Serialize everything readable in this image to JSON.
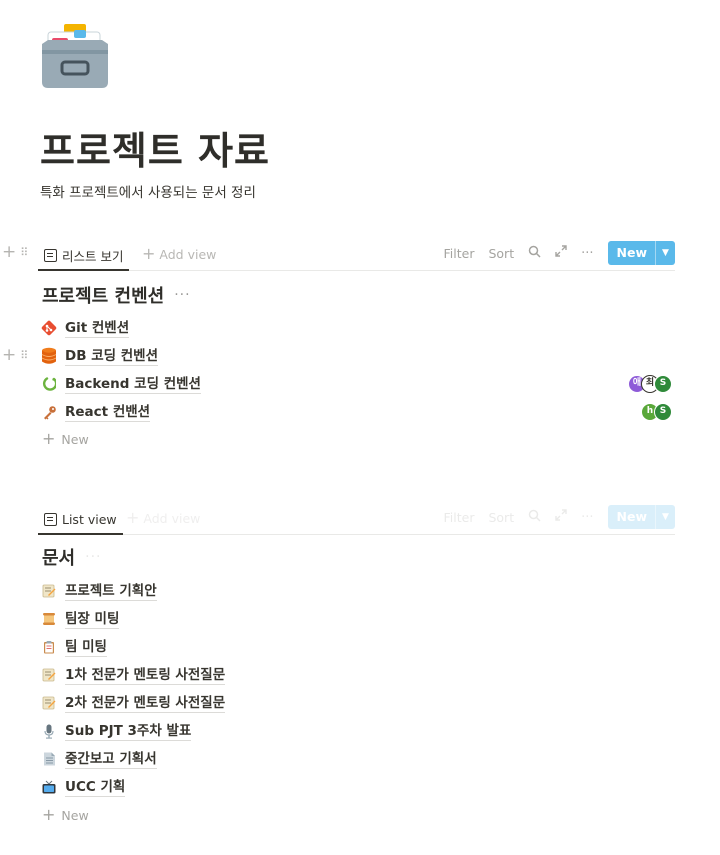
{
  "page": {
    "icon": "card-file-box-icon",
    "title": "프로젝트 자료",
    "description": "특화 프로젝트에서 사용되는 문서 정리"
  },
  "db1": {
    "tab_label": "리스트 보기",
    "add_view": "Add view",
    "filter": "Filter",
    "sort": "Sort",
    "new_label": "New",
    "title": "프로젝트 컨벤션",
    "title_more": "···",
    "items": [
      {
        "icon": "git-icon",
        "label": "Git 컨벤션",
        "avatars": []
      },
      {
        "icon": "database-icon",
        "label": "DB 코딩 컨벤션",
        "avatars": []
      },
      {
        "icon": "spring-leaf-icon",
        "label": "Backend 코딩 컨벤션",
        "avatars": [
          {
            "text": "애",
            "color": "#8e5bd8",
            "text_color": "#ffffff"
          },
          {
            "text": "최",
            "color": "#ffffff",
            "text_color": "#37352f"
          },
          {
            "text": "S",
            "color": "#2f8a3a",
            "text_color": "#ffffff"
          }
        ]
      },
      {
        "icon": "key-icon",
        "label": "React 컨밴션",
        "avatars": [
          {
            "text": "h",
            "color": "#5aa83a",
            "text_color": "#ffffff"
          },
          {
            "text": "S",
            "color": "#2f8a3a",
            "text_color": "#ffffff"
          }
        ]
      }
    ],
    "new_row": "New"
  },
  "db2": {
    "tab_label": "List view",
    "add_view": "Add view",
    "filter": "Filter",
    "sort": "Sort",
    "new_label": "New",
    "title": "문서",
    "title_more": "···",
    "items": [
      {
        "icon": "memo-icon",
        "label": "프로젝트 기획안"
      },
      {
        "icon": "scroll-icon",
        "label": "팀장 미팅"
      },
      {
        "icon": "clipboard-icon",
        "label": "팀 미팅"
      },
      {
        "icon": "memo-icon",
        "label": "1차 전문가 멘토링 사전질문"
      },
      {
        "icon": "memo-icon",
        "label": "2차 전문가 멘토링 사전질문"
      },
      {
        "icon": "microphone-icon",
        "label": "Sub PJT 3주차 발표"
      },
      {
        "icon": "document-icon",
        "label": "중간보고 기획서"
      },
      {
        "icon": "television-icon",
        "label": "UCC 기획"
      }
    ],
    "new_row": "New"
  },
  "colors": {
    "accent": "#5ab9ea",
    "text": "#37352f",
    "muted": "#a5a4a0"
  }
}
